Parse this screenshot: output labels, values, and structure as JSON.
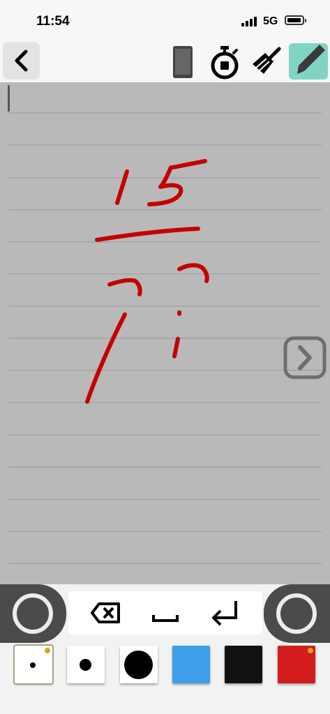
{
  "status_bar": {
    "time": "11:54",
    "network": "5G"
  },
  "toolbar": {
    "icons": [
      "chevron-left-icon",
      "phone-icon",
      "stopwatch-icon",
      "broom-icon",
      "pencil-icon"
    ],
    "active_tool": "pencil"
  },
  "canvas": {
    "ink_color": "#cc0000",
    "background": "#b9b9b9"
  },
  "keys": {
    "icons": [
      "backspace-icon",
      "space-icon",
      "return-icon"
    ]
  },
  "palette": {
    "swatches": [
      {
        "name": "small-pen",
        "color": "#ffffff",
        "selected": true
      },
      {
        "name": "medium-pen",
        "color": "#ffffff",
        "selected": false
      },
      {
        "name": "large-pen",
        "color": "#ffffff",
        "selected": false
      },
      {
        "name": "blue",
        "color": "#3f9ee8",
        "selected": false
      },
      {
        "name": "black",
        "color": "#111111",
        "selected": false
      },
      {
        "name": "red",
        "color": "#d31d1d",
        "selected": true
      }
    ]
  }
}
